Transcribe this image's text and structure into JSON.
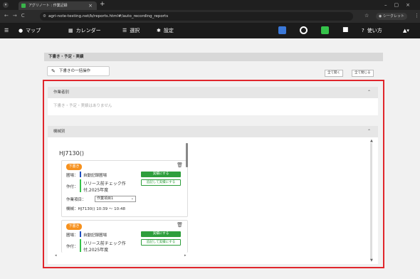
{
  "browser": {
    "tab_title": "アグリノート : 作業記録",
    "url": "agri-note-testing.net/b/reports.html#/auto_recording_reports",
    "secret_label": "シークレット"
  },
  "appbar": {
    "map": "マップ",
    "calendar": "カレンダー",
    "select": "選択",
    "settings": "設定",
    "help": "使い方"
  },
  "page": {
    "section_title": "下書き・予定・実績",
    "bulk_button": "下書きの一括操作",
    "open_all": "全て開く",
    "close_all": "全て閉じる"
  },
  "panel_by_work": {
    "header": "作業者別",
    "empty_text": "下書き・予定・実績はありません"
  },
  "panel_by_machine": {
    "header": "機械別",
    "device_name": "HJ7130()",
    "cards": [
      {
        "badge": "下書き",
        "field_label": "圃場：",
        "field_value": "自動記録圃場",
        "crop_label": "作付：",
        "crop_value_1": "リリース前チェック作",
        "crop_value_2": "付,2025年度",
        "btn_actual": "実績にする",
        "btn_append": "追記して実績にする",
        "work_label": "作業項目：",
        "work_value": "作業項目1",
        "machine_text": "機械：HJ7130() 10:39 〜 10:48"
      },
      {
        "badge": "下書き",
        "field_label": "圃場：",
        "field_value": "自動記録圃場",
        "crop_label": "作付：",
        "crop_value_1": "リリース前チェック作",
        "crop_value_2": "付,2025年度",
        "btn_actual": "実績にする",
        "btn_append": "追記して実績にする"
      }
    ]
  },
  "colors": {
    "highlight_frame": "#e0262c",
    "badge": "#f6911e",
    "green": "#2e9e3c",
    "field_bar": "#1f4fbf",
    "crop_bar": "#35c24a"
  }
}
